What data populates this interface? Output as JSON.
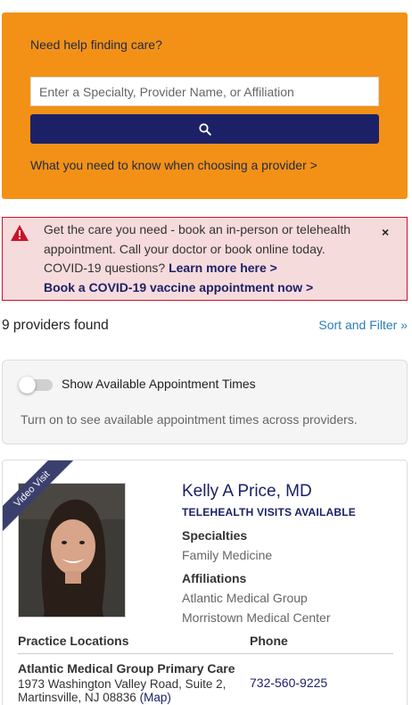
{
  "search": {
    "help_text": "Need help finding care?",
    "placeholder": "Enter a Specialty, Provider Name, or Affiliation",
    "value": "",
    "know_link": "What you need to know when choosing a provider >"
  },
  "alert": {
    "line1": "Get the care you need - book an in-person or telehealth appointment. Call your doctor or book online today. COVID-19 questions?",
    "learn_more": "Learn more here >",
    "vaccine_link": "Book a COVID-19 vaccine appointment now >",
    "close": "×"
  },
  "results": {
    "count": "9 providers found",
    "sort_filter": "Sort and Filter »"
  },
  "availability": {
    "toggle_on": false,
    "label": "Show Available Appointment Times",
    "hint": "Turn on to see available appointment times across providers."
  },
  "provider": {
    "ribbon": "Video Visit",
    "name": "Kelly A Price, MD",
    "telehealth": "TELEHEALTH VISITS AVAILABLE",
    "specialties_label": "Specialties",
    "specialties": [
      "Family Medicine"
    ],
    "affiliations_label": "Affiliations",
    "affiliations": [
      "Atlantic Medical Group",
      "Morristown Medical Center"
    ],
    "locations_header": "Practice Locations",
    "phone_header": "Phone",
    "location": {
      "name": "Atlantic Medical Group Primary Care",
      "address_line1": "1973 Washington Valley Road, Suite 2,",
      "address_line2": "Martinsville, NJ 08836",
      "map_link": "(Map)",
      "phone": "732-560-9225"
    }
  },
  "colors": {
    "accent_orange": "#f39117",
    "navy": "#1c2167",
    "alert_bg": "#f6dbdd",
    "alert_border": "#c9132a",
    "link_blue": "#2b7fb8"
  }
}
